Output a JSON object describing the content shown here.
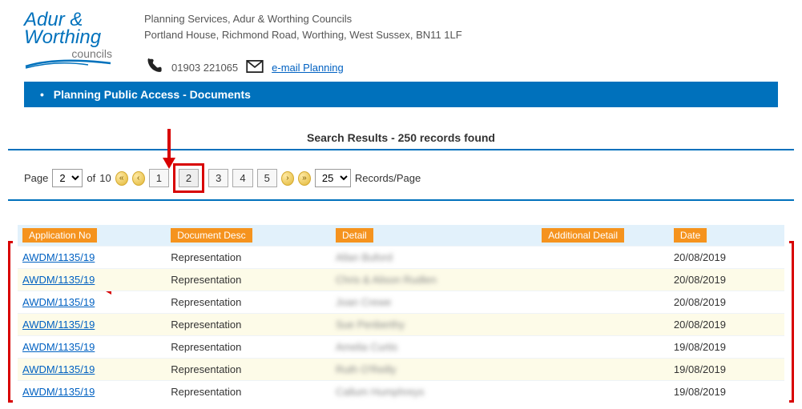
{
  "header": {
    "logo_line1": "Adur &",
    "logo_line2": "Worthing",
    "logo_line3": "councils",
    "address_line1": "Planning Services, Adur & Worthing Councils",
    "address_line2": "Portland House, Richmond Road, Worthing, West Sussex, BN11 1LF",
    "phone": "01903 221065",
    "email_link": "e-mail Planning"
  },
  "navbar": {
    "title": "Planning Public Access - Documents"
  },
  "search": {
    "results_title": "Search Results - 250 records found",
    "page_label_prefix": "Page",
    "page_label_mid": "of",
    "total_pages": "10",
    "current_page": "2",
    "records_per_page_label": "Records/Page",
    "records_per_page": "25",
    "page_buttons": [
      "1",
      "2",
      "3",
      "4",
      "5"
    ]
  },
  "table": {
    "headers": {
      "appno": "Application No",
      "desc": "Document Desc",
      "detail": "Detail",
      "additional": "Additional Detail",
      "date": "Date"
    },
    "rows": [
      {
        "appno": "AWDM/1135/19",
        "desc": "Representation",
        "detail": "Allan Buford",
        "additional": "",
        "date": "20/08/2019"
      },
      {
        "appno": "AWDM/1135/19",
        "desc": "Representation",
        "detail": "Chris & Alison Rudlen",
        "additional": "",
        "date": "20/08/2019"
      },
      {
        "appno": "AWDM/1135/19",
        "desc": "Representation",
        "detail": "Joan Crewe",
        "additional": "",
        "date": "20/08/2019"
      },
      {
        "appno": "AWDM/1135/19",
        "desc": "Representation",
        "detail": "Sue Penberthy",
        "additional": "",
        "date": "20/08/2019"
      },
      {
        "appno": "AWDM/1135/19",
        "desc": "Representation",
        "detail": "Amelia Curtis",
        "additional": "",
        "date": "19/08/2019"
      },
      {
        "appno": "AWDM/1135/19",
        "desc": "Representation",
        "detail": "Ruth O'Reilly",
        "additional": "",
        "date": "19/08/2019"
      },
      {
        "appno": "AWDM/1135/19",
        "desc": "Representation",
        "detail": "Callum Humphreys",
        "additional": "",
        "date": "19/08/2019"
      }
    ]
  },
  "colors": {
    "brand_blue": "#0071bc",
    "accent_orange": "#f5931e",
    "annotation_red": "#d80000"
  }
}
